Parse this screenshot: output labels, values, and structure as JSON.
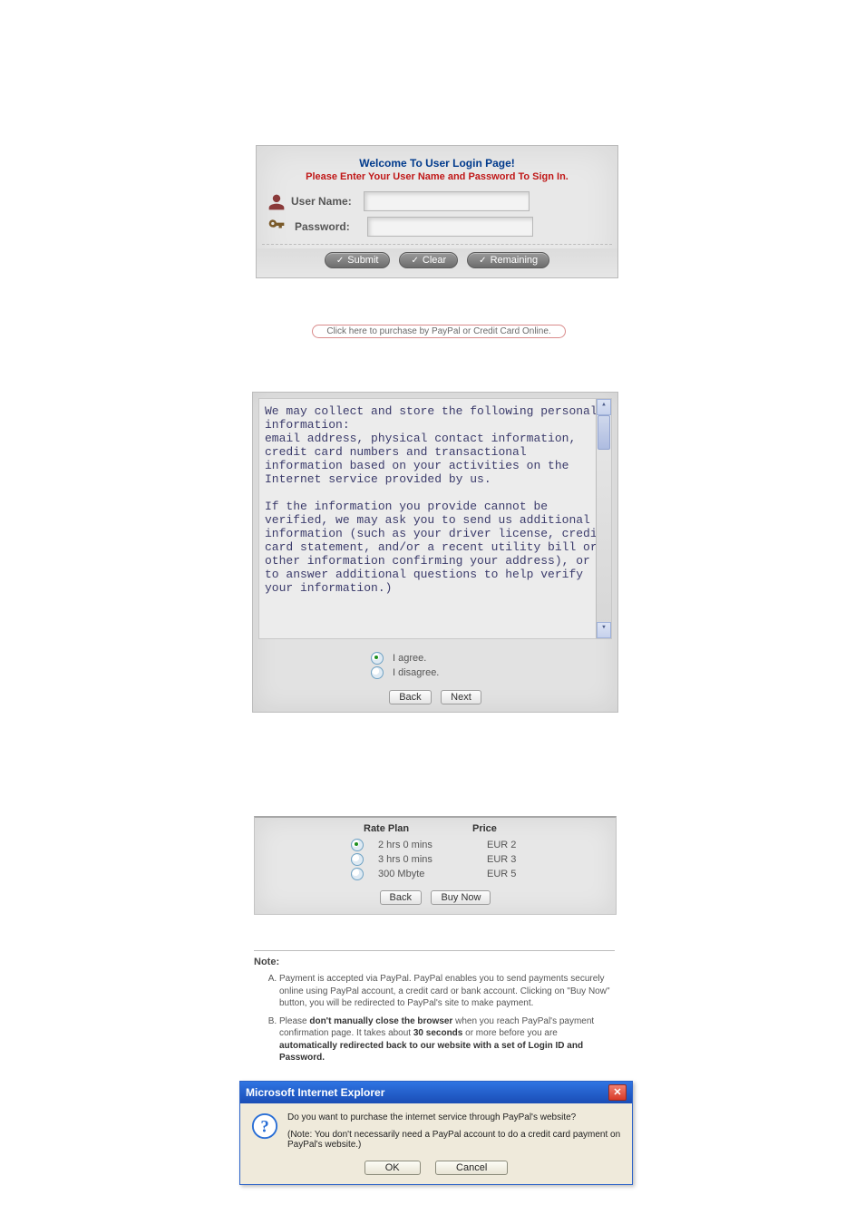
{
  "login": {
    "title": "Welcome To User Login Page!",
    "subtitle": "Please Enter Your User Name and Password To Sign In.",
    "username_label": "User Name:",
    "password_label": "Password:",
    "submit_label": "Submit",
    "clear_label": "Clear",
    "remaining_label": "Remaining",
    "purchase_link": "Click here to purchase by PayPal or Credit Card Online."
  },
  "agreement": {
    "paragraph1": "We may collect and store the following personal information:",
    "paragraph2": "email address, physical contact information, credit card numbers and transactional information based on your activities on the Internet service provided by us.",
    "paragraph3": "If the information you provide cannot be verified, we may ask you to send us additional information (such as your driver license, credit card statement, and/or a recent utility bill or other information confirming your address), or to answer additional questions to help verify your information.)",
    "agree_label": "I agree.",
    "disagree_label": "I disagree.",
    "back_label": "Back",
    "next_label": "Next"
  },
  "rate": {
    "header_plan": "Rate Plan",
    "header_price": "Price",
    "rows": [
      {
        "plan": "2 hrs 0 mins",
        "price": "EUR 2",
        "selected": true
      },
      {
        "plan": "3 hrs 0 mins",
        "price": "EUR 3",
        "selected": false
      },
      {
        "plan": "300 Mbyte",
        "price": "EUR 5",
        "selected": false
      }
    ],
    "back_label": "Back",
    "buy_label": "Buy Now"
  },
  "note": {
    "heading": "Note:",
    "item_a_prefix": "Payment is accepted via PayPal. PayPal enables you to send payments securely online using PayPal account, a credit card or bank account. Clicking on \"Buy Now\" button, you will be redirected to PayPal's site to make payment.",
    "item_b_p1": "Please ",
    "item_b_b1": "don't manually close the browser",
    "item_b_p2": " when you reach PayPal's payment confirmation page. It takes about ",
    "item_b_b2": "30 seconds",
    "item_b_p3": " or more before you are ",
    "item_b_b3": "automatically redirected back to our website with a set of Login ID and Password."
  },
  "dialog": {
    "title": "Microsoft Internet Explorer",
    "line1": "Do you want to purchase the internet service through PayPal's website?",
    "line2": "(Note: You don't necessarily need a PayPal account to do a credit card payment on PayPal's website.)",
    "ok_label": "OK",
    "cancel_label": "Cancel"
  }
}
